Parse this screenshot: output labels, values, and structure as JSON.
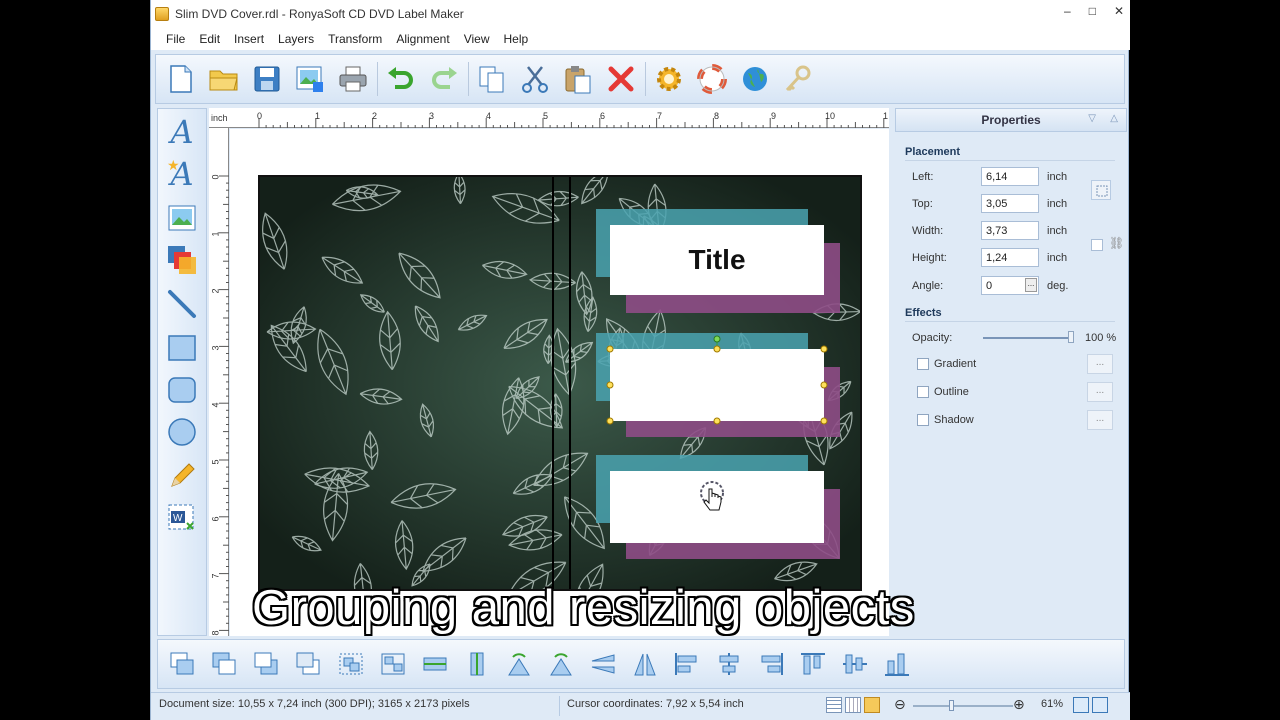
{
  "window": {
    "title": "Slim DVD Cover.rdl - RonyaSoft CD DVD Label Maker",
    "minimize": "–",
    "maximize": "□",
    "close": "✕"
  },
  "menu": [
    "File",
    "Edit",
    "Insert",
    "Layers",
    "Transform",
    "Alignment",
    "View",
    "Help"
  ],
  "ruler": {
    "unit": "inch",
    "top_labels": [
      "0",
      "1",
      "2",
      "3",
      "4",
      "5",
      "6",
      "7",
      "8",
      "9",
      "10",
      "1"
    ],
    "left_labels": [
      "0",
      "1",
      "2",
      "3",
      "4",
      "5",
      "6",
      "7",
      "8"
    ]
  },
  "canvas": {
    "title_text": "Title"
  },
  "properties": {
    "header": "Properties",
    "placement_title": "Placement",
    "fields": [
      {
        "label": "Left:",
        "value": "6,14",
        "unit": "inch"
      },
      {
        "label": "Top:",
        "value": "3,05",
        "unit": "inch"
      },
      {
        "label": "Width:",
        "value": "3,73",
        "unit": "inch"
      },
      {
        "label": "Height:",
        "value": "1,24",
        "unit": "inch"
      },
      {
        "label": "Angle:",
        "value": "0",
        "unit": "deg."
      }
    ],
    "effects_title": "Effects",
    "opacity_label": "Opacity:",
    "opacity_value": "100 %",
    "opacity_level": 1.0,
    "checkboxes": [
      {
        "label": "Gradient",
        "checked": false
      },
      {
        "label": "Outline",
        "checked": false
      },
      {
        "label": "Shadow",
        "checked": false
      }
    ],
    "dots": "..."
  },
  "status": {
    "document_size": "Document size: 10,55 x 7,24 inch (300 DPI); 3165 x 2173 pixels",
    "cursor": "Cursor coordinates: 7,92 x 5,54 inch",
    "zoom": "61%"
  },
  "caption": "Grouping and resizing objects",
  "colors": {
    "teal": "#4aa3b0",
    "purple": "#8e4d86",
    "toolbar_bg": "#dfeaf6"
  }
}
